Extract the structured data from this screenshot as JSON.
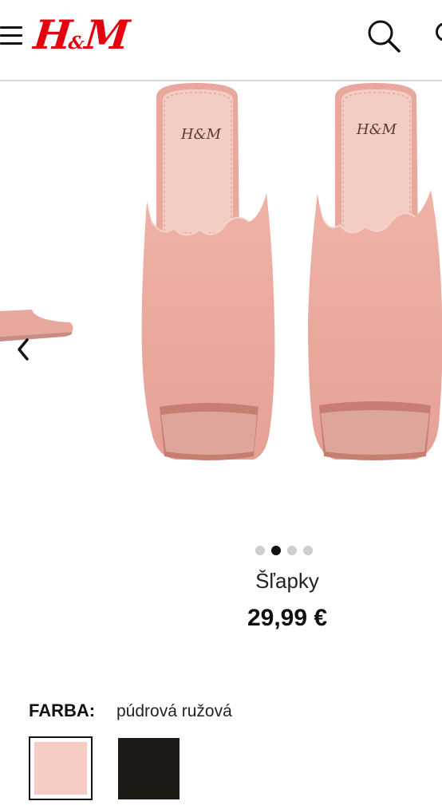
{
  "header": {
    "logo_main": "H",
    "logo_amp": "&",
    "logo_end": "M",
    "icons": [
      "menu-icon",
      "search-icon",
      "cart-icon"
    ]
  },
  "gallery": {
    "sole_brand": "H&M",
    "dots_count": 4,
    "active_dot": 2
  },
  "product": {
    "name": "Šľapky",
    "price": "29,99 €"
  },
  "color": {
    "label": "FARBA:",
    "selected_value": "púdrová ružová",
    "swatches": [
      {
        "name": "púdrová ružová",
        "hex": "#f6cbc4",
        "selected": true
      },
      {
        "name": "čierna",
        "hex": "#1e1a16",
        "selected": false
      }
    ]
  },
  "colors": {
    "brand_red": "#e50010",
    "shoe_pink": "#ebaa9f",
    "insole": "#f3cdc3"
  }
}
